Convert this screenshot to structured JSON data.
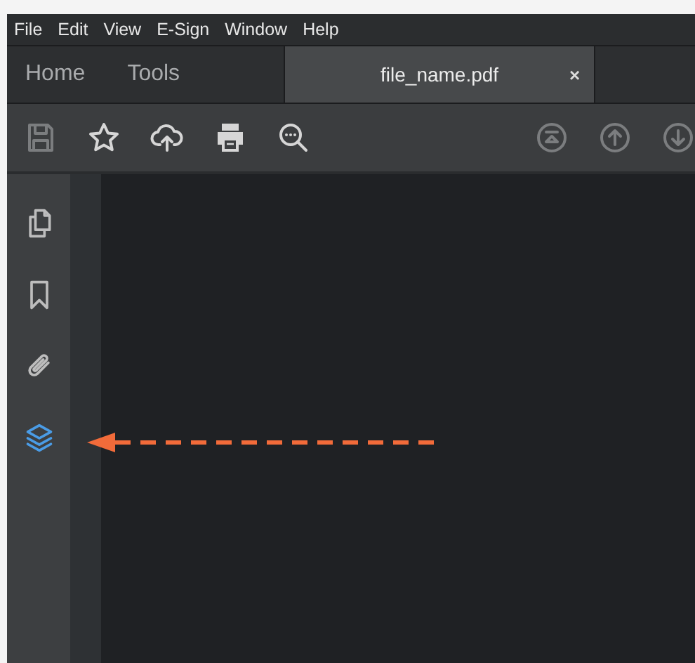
{
  "menu": [
    "File",
    "Edit",
    "View",
    "E-Sign",
    "Window",
    "Help"
  ],
  "tabs": [
    {
      "label": "Home",
      "selected": false
    },
    {
      "label": "Tools",
      "selected": false
    },
    {
      "label": "file_name.pdf",
      "selected": true,
      "close": "×"
    }
  ],
  "toolbar": [
    {
      "kind": "save",
      "disabled": true
    },
    {
      "kind": "star",
      "disabled": false
    },
    {
      "kind": "upload",
      "disabled": false
    },
    {
      "kind": "print",
      "disabled": false
    },
    {
      "kind": "zoom",
      "disabled": false
    },
    {
      "kind": "first",
      "disabled": true
    },
    {
      "kind": "up",
      "disabled": true
    },
    {
      "kind": "down",
      "disabled": true
    }
  ],
  "sidebar": {
    "items": [
      {
        "kind": "pages",
        "selected": false
      },
      {
        "kind": "bookmark",
        "selected": false
      },
      {
        "kind": "attachment",
        "selected": false
      },
      {
        "kind": "layers",
        "selected": true
      }
    ]
  },
  "annotation": {
    "kind": "arrow",
    "color": "#f26b3a"
  }
}
